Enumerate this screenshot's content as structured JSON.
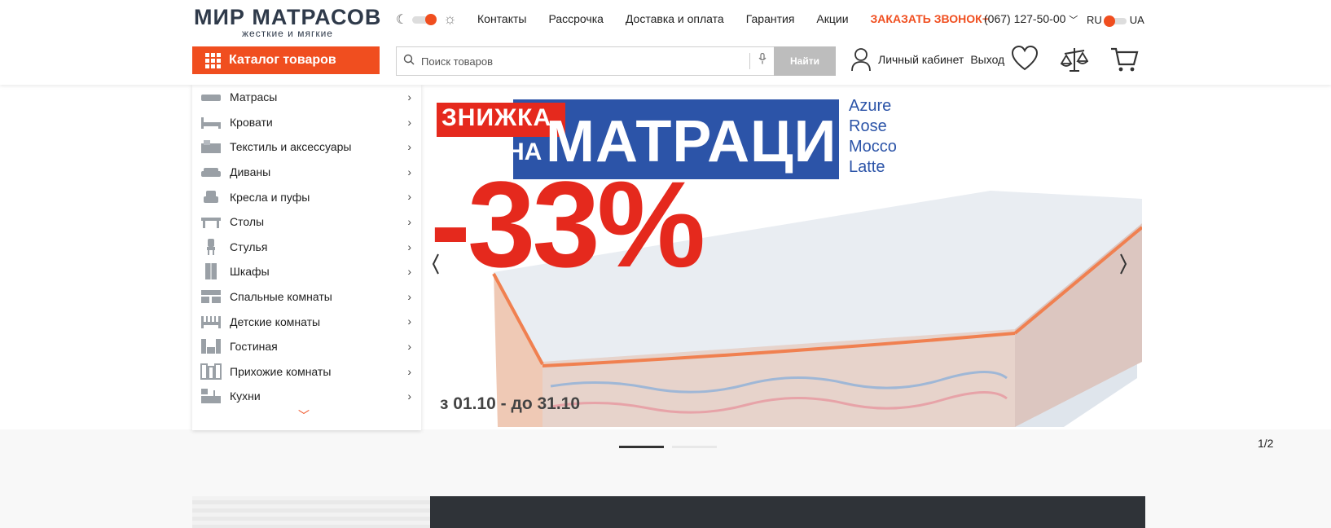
{
  "logo": {
    "main": "МИР МАТРАСОВ",
    "sub": "жесткие и мягкие"
  },
  "nav": {
    "items": [
      "Контакты",
      "Рассрочка",
      "Доставка и оплата",
      "Гарантия",
      "Акции"
    ],
    "cta": "ЗАКАЗАТЬ ЗВОНОК+"
  },
  "phone": "(067) 127-50-00",
  "lang": {
    "ru": "RU",
    "ua": "UA"
  },
  "catalog_button": "Каталог товаров",
  "search": {
    "placeholder": "Поиск товаров",
    "button": "Найти"
  },
  "account": {
    "cabinet": "Личный кабинет",
    "logout": "Выход"
  },
  "menu": {
    "items": [
      {
        "label": "Матрасы",
        "icon": "mattress-icon"
      },
      {
        "label": "Кровати",
        "icon": "bed-icon"
      },
      {
        "label": "Текстиль и аксессуары",
        "icon": "textile-icon"
      },
      {
        "label": "Диваны",
        "icon": "sofa-icon"
      },
      {
        "label": "Кресла и пуфы",
        "icon": "armchair-icon"
      },
      {
        "label": "Столы",
        "icon": "table-icon"
      },
      {
        "label": "Стулья",
        "icon": "chair-icon"
      },
      {
        "label": "Шкафы",
        "icon": "wardrobe-icon"
      },
      {
        "label": "Спальные комнаты",
        "icon": "bedroom-icon"
      },
      {
        "label": "Детские комнаты",
        "icon": "kids-room-icon"
      },
      {
        "label": "Гостиная",
        "icon": "living-room-icon"
      },
      {
        "label": "Прихожие комнаты",
        "icon": "hallway-icon"
      },
      {
        "label": "Кухни",
        "icon": "kitchen-icon"
      }
    ]
  },
  "banner": {
    "badge_top": "ЗНИЖКА",
    "badge_bottom": "НА",
    "headline": "МАТРАЦИ",
    "models": [
      "Azure",
      "Rose",
      "Mocco",
      "Latte"
    ],
    "discount": "-33%",
    "dates": "з 01.10 - до 31.10"
  },
  "slider": {
    "counter": "1/2",
    "active_slide": 1,
    "total_slides": 2
  },
  "colors": {
    "accent": "#f04e1f",
    "logo": "#2f3a4a",
    "banner_blue": "#2c54a8",
    "banner_red": "#e5291d"
  }
}
